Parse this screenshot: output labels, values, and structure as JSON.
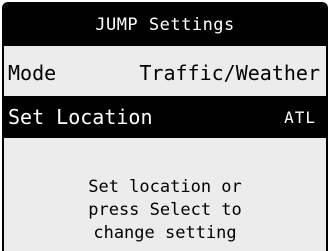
{
  "title": "JUMP Settings",
  "rows": [
    {
      "label": "Mode",
      "value": "Traffic/Weather"
    },
    {
      "label": "Set Location",
      "value": "ATL"
    }
  ],
  "help": {
    "line1": "Set location or",
    "line2": "press Select to",
    "line3": "change setting"
  }
}
